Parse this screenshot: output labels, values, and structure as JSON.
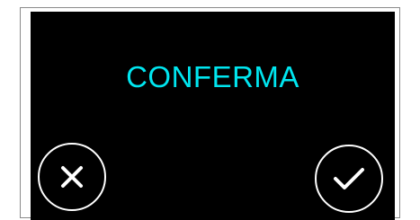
{
  "dialog": {
    "title": "CONFERMA",
    "title_color": "#00e6f0",
    "background_color": "#000000"
  },
  "buttons": {
    "cancel": {
      "icon": "close-icon"
    },
    "confirm": {
      "icon": "checkmark-icon"
    }
  }
}
